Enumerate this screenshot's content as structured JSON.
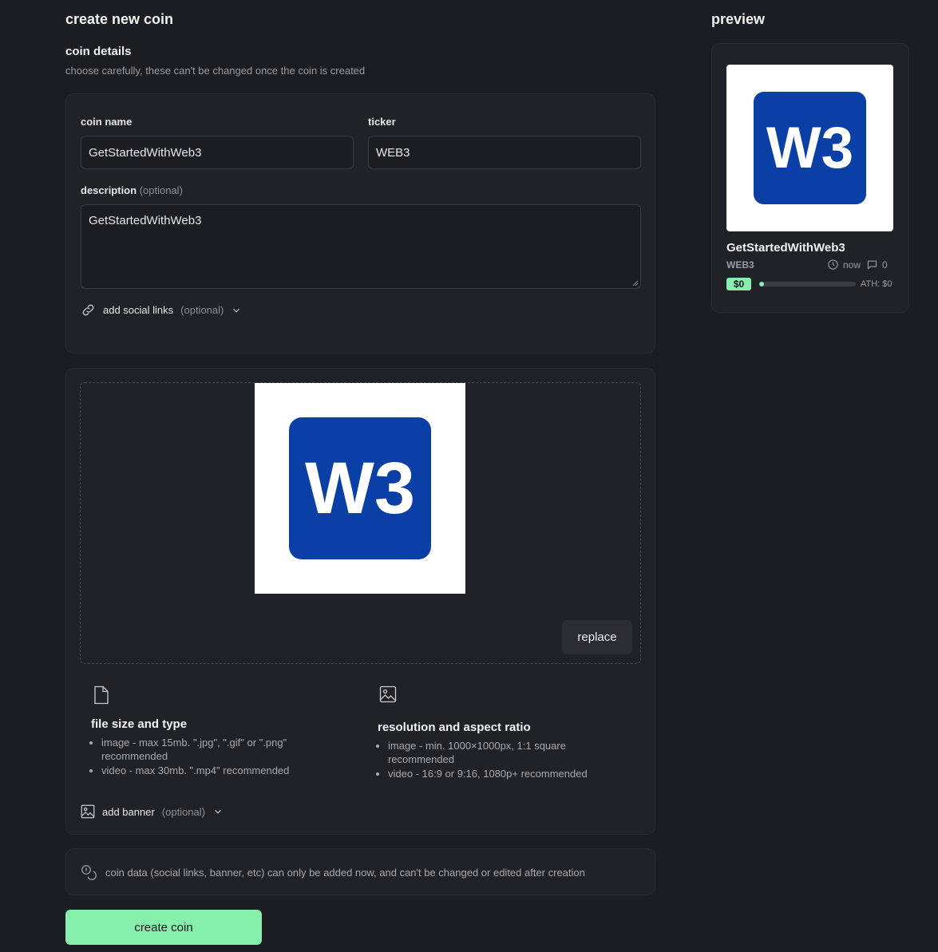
{
  "form": {
    "title": "create new coin",
    "section_title": "coin details",
    "section_subtitle": "choose carefully, these can't be changed once the coin is created",
    "coin_name_label": "coin name",
    "coin_name_value": "GetStartedWithWeb3",
    "ticker_label": "ticker",
    "ticker_value": "WEB3",
    "description_label": "description",
    "description_optional": "(optional)",
    "description_value": "GetStartedWithWeb3",
    "social_links_label": "add social links",
    "social_links_optional": "(optional)"
  },
  "media": {
    "logo_text": "W3",
    "logo_color": "#0a3fa5",
    "replace_label": "replace",
    "file_req_title": "file size and type",
    "file_req_items": [
      "image - max 15mb. \".jpg\", \".gif\" or \".png\" recommended",
      "video - max 30mb. \".mp4\" recommended"
    ],
    "res_req_title": "resolution and aspect ratio",
    "res_req_items": [
      "image - min. 1000×1000px, 1:1 square recommended",
      "video - 16:9 or 9:16, 1080p+ recommended"
    ],
    "banner_label": "add banner",
    "banner_optional": "(optional)"
  },
  "notice": {
    "text": "coin data (social links, banner, etc) can only be added now, and can't be changed or edited after creation"
  },
  "actions": {
    "create_label": "create coin",
    "accent": "#86efac"
  },
  "preview": {
    "title": "preview",
    "name": "GetStartedWithWeb3",
    "ticker": "WEB3",
    "time": "now",
    "comments": "0",
    "market_cap": "$0",
    "ath": "ATH: $0",
    "progress_fraction": 0.04
  }
}
